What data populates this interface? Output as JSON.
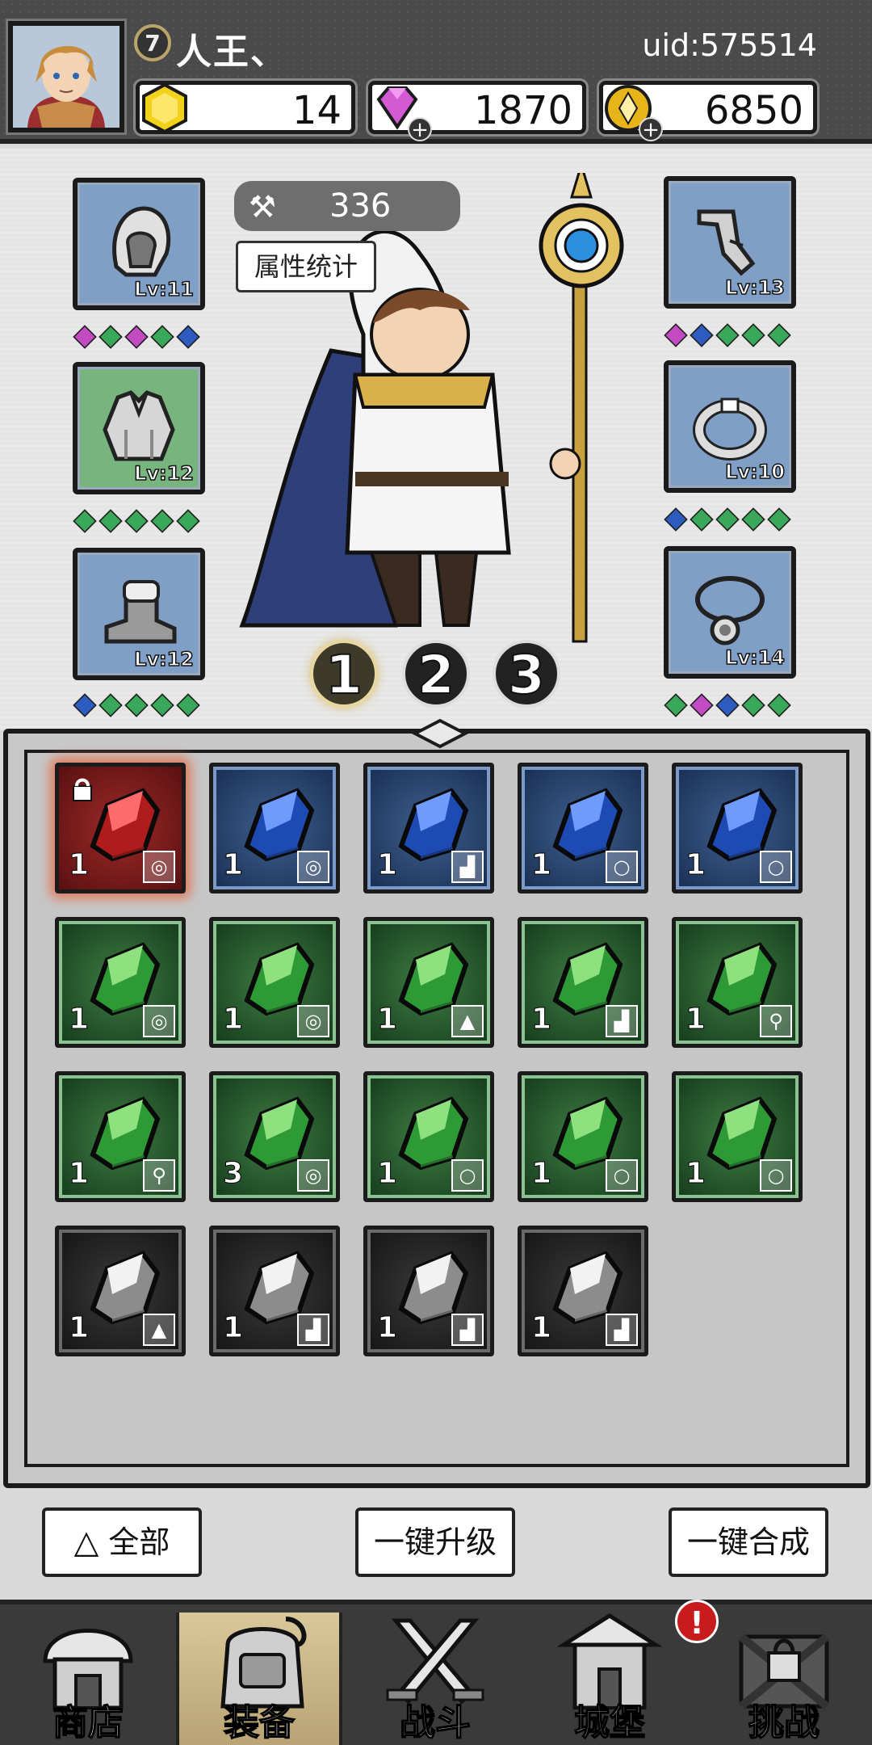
{
  "player": {
    "level": "7",
    "name": "人王、",
    "uid": "uid:575514"
  },
  "resources": [
    {
      "icon": "gold-hex-icon",
      "value": "14"
    },
    {
      "icon": "diamond-icon",
      "value": "1870"
    },
    {
      "icon": "coin-icon",
      "value": "6850"
    }
  ],
  "equip": {
    "power_icon": "hammer-icon",
    "power": "336",
    "stats_label": "属性统计",
    "slots_left": [
      {
        "icon": "helmet-icon",
        "lv": "Lv:11",
        "color": "blue",
        "gems": [
          "#c24bc4",
          "#3aa85a",
          "#c24bc4",
          "#3aa85a",
          "#2d5bbf"
        ]
      },
      {
        "icon": "armor-icon",
        "lv": "Lv:12",
        "color": "green",
        "gems": [
          "#3aa85a",
          "#3aa85a",
          "#3aa85a",
          "#3aa85a",
          "#3aa85a"
        ]
      },
      {
        "icon": "boot-icon",
        "lv": "Lv:12",
        "color": "blue",
        "gems": [
          "#2d5bbf",
          "#3aa85a",
          "#3aa85a",
          "#3aa85a",
          "#3aa85a"
        ]
      }
    ],
    "slots_right": [
      {
        "icon": "gauntlet-icon",
        "lv": "Lv:13",
        "color": "blue",
        "gems": [
          "#c24bc4",
          "#2d5bbf",
          "#3aa85a",
          "#3aa85a",
          "#3aa85a"
        ]
      },
      {
        "icon": "ring-icon",
        "lv": "Lv:10",
        "color": "blue",
        "gems": [
          "#2d5bbf",
          "#3aa85a",
          "#3aa85a",
          "#3aa85a",
          "#3aa85a"
        ]
      },
      {
        "icon": "necklace-icon",
        "lv": "Lv:14",
        "color": "blue",
        "gems": [
          "#3aa85a",
          "#c24bc4",
          "#2d5bbf",
          "#3aa85a",
          "#3aa85a"
        ]
      }
    ],
    "pages": [
      "1",
      "2",
      "3"
    ],
    "active_page": "1"
  },
  "inventory": [
    {
      "color": "red",
      "count": "1",
      "tag": "ring-icon",
      "locked": true
    },
    {
      "color": "blue",
      "count": "1",
      "tag": "ring-icon"
    },
    {
      "color": "blue",
      "count": "1",
      "tag": "boot-icon"
    },
    {
      "color": "blue",
      "count": "1",
      "tag": "necklace-icon"
    },
    {
      "color": "blue",
      "count": "1",
      "tag": "necklace-icon"
    },
    {
      "color": "green",
      "count": "1",
      "tag": "ring-icon"
    },
    {
      "color": "green",
      "count": "1",
      "tag": "ring-icon"
    },
    {
      "color": "green",
      "count": "1",
      "tag": "armor-icon"
    },
    {
      "color": "green",
      "count": "1",
      "tag": "boot-icon"
    },
    {
      "color": "green",
      "count": "1",
      "tag": "weapon-icon"
    },
    {
      "color": "green",
      "count": "1",
      "tag": "weapon-icon"
    },
    {
      "color": "green",
      "count": "3",
      "tag": "ring-icon"
    },
    {
      "color": "green",
      "count": "1",
      "tag": "necklace-icon"
    },
    {
      "color": "green",
      "count": "1",
      "tag": "necklace-icon"
    },
    {
      "color": "green",
      "count": "1",
      "tag": "necklace-icon"
    },
    {
      "color": "gray",
      "count": "1",
      "tag": "armor-icon"
    },
    {
      "color": "gray",
      "count": "1",
      "tag": "boot-icon"
    },
    {
      "color": "gray",
      "count": "1",
      "tag": "boot-icon"
    },
    {
      "color": "gray",
      "count": "1",
      "tag": "boot-icon"
    }
  ],
  "buttons": {
    "all": "全部",
    "upgrade": "一键升级",
    "merge": "一键合成"
  },
  "tabs": [
    {
      "label": "商店",
      "icon": "shop-icon"
    },
    {
      "label": "装备",
      "icon": "backpack-icon",
      "active": true
    },
    {
      "label": "战斗",
      "icon": "crossed-swords-icon"
    },
    {
      "label": "城堡",
      "icon": "castle-icon",
      "alert": "!"
    },
    {
      "label": "挑战",
      "icon": "locked-chest-icon"
    }
  ],
  "colors": {
    "rarity_red": "#9d2a2a",
    "rarity_blue": "#3f5f8f",
    "rarity_green": "#3e7d44",
    "rarity_gray": "#3a3a3a"
  }
}
